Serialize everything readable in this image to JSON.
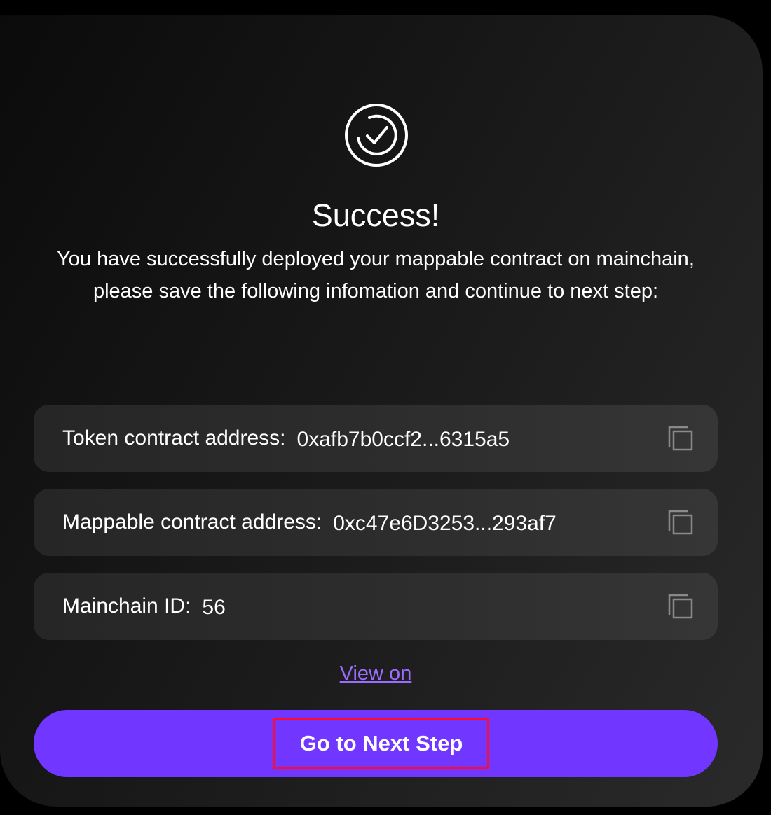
{
  "dialog": {
    "icon": "check-circle-icon",
    "title": "Success!",
    "description": "You have successfully deployed your mappable contract on mainchain, please save the following infomation and continue to next step:"
  },
  "info_rows": [
    {
      "label": "Token contract address:",
      "value": "0xafb7b0ccf2...6315a5",
      "icon": "copy-icon"
    },
    {
      "label": "Mappable contract address:",
      "value": "0xc47e6D3253...293af7",
      "icon": "copy-icon"
    },
    {
      "label": "Mainchain ID:",
      "value": "56",
      "icon": "copy-icon"
    }
  ],
  "view_link": {
    "label": "View on"
  },
  "next_button": {
    "label": "Go to Next Step"
  },
  "colors": {
    "background": "#000000",
    "card": "#1a1a1a",
    "row": "#2e2e2e",
    "accent": "#7136ff",
    "link": "#9b6cff",
    "highlight_outline": "#ff0b2e",
    "text": "#ffffff"
  }
}
